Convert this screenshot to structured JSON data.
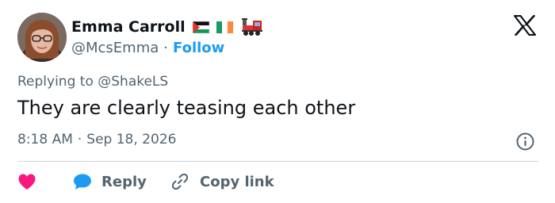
{
  "user": {
    "display_name": "Emma Carroll",
    "handle": "@McsEmma",
    "follow_label": "Follow",
    "separator": "·",
    "badges": [
      "palestine-flag-icon",
      "ireland-flag-icon",
      "train-icon"
    ]
  },
  "tweet": {
    "replying_prefix": "Replying to",
    "replying_handle": "@ShakeLS",
    "text": "They are clearly teasing each other",
    "time": "8:18 AM",
    "separator": "·",
    "date": "Sep 18, 2026"
  },
  "actions": {
    "reply_label": "Reply",
    "copy_link_label": "Copy link"
  },
  "colors": {
    "accent": "#1d9bf0",
    "like": "#f91880",
    "text": "#0f1419",
    "muted": "#536471",
    "divider": "#cfd9de"
  }
}
